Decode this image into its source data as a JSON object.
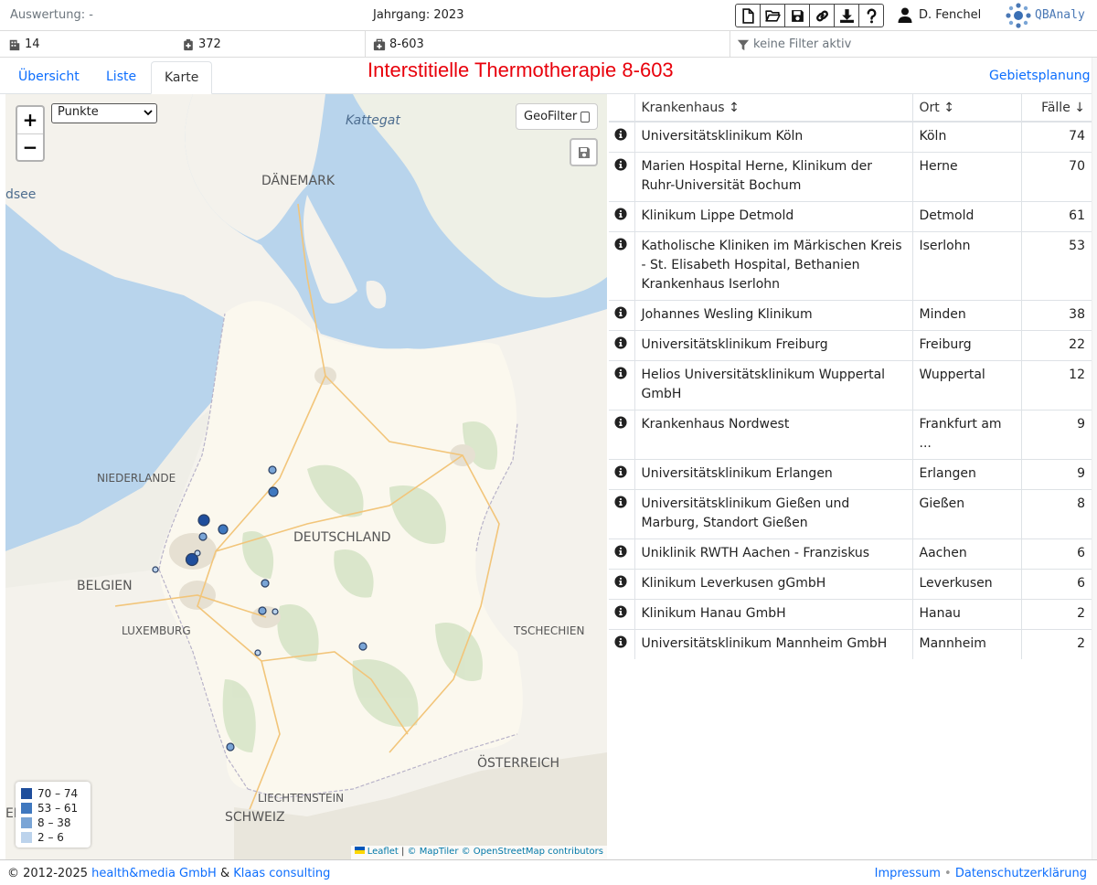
{
  "header": {
    "evaluation_label": "Auswertung:",
    "evaluation_value": "-",
    "year_label": "Jahrgang:",
    "year_value": "2023",
    "user_name": "D. Fenchel",
    "logo_text": "QBAnaly",
    "toolbar_icons": [
      "new-file-icon",
      "open-folder-icon",
      "save-icon",
      "link-icon",
      "download-icon",
      "help-icon"
    ]
  },
  "stats": {
    "hospitals": "14",
    "cases": "372",
    "procedure": "8-603",
    "filter_text": "keine Filter aktiv"
  },
  "tabs": [
    {
      "label": "Übersicht",
      "active": false
    },
    {
      "label": "Liste",
      "active": false
    },
    {
      "label": "Karte",
      "active": true
    }
  ],
  "page_title": "Interstitielle Thermotherapie 8-603",
  "region_link": "Gebietsplanung",
  "map": {
    "layer_select_value": "Punkte",
    "geofilter_label": "GeoFilter",
    "geofilter_checked": false,
    "zoom_in": "+",
    "zoom_out": "−",
    "labels": {
      "kattegat": "Kattegat",
      "daenemark": "DÄNEMARK",
      "dsee": "dsee",
      "niederlande": "NIEDERLANDE",
      "deutschland": "DEUTSCHLAND",
      "belgien": "BELGIEN",
      "luxemburg": "LUXEMBURG",
      "tschechien": "TSCHECHIEN",
      "oesterreich": "ÖSTERREICH",
      "liechtenstein": "LIECHTENSTEIN",
      "schweiz": "SCHWEIZ",
      "ei": "EI"
    },
    "legend": [
      {
        "label": "70 – 74",
        "color": "#1f4e9c"
      },
      {
        "label": "53 – 61",
        "color": "#3f78bf"
      },
      {
        "label": "8 – 38",
        "color": "#7aa5d6"
      },
      {
        "label": "2 – 6",
        "color": "#bcd3ec"
      }
    ],
    "attribution": {
      "leaflet": "Leaflet",
      "sep1": " | ",
      "maptiler": "© MapTiler",
      "sep2": " ",
      "osm": "© OpenStreetMap contributors"
    }
  },
  "table": {
    "headers": {
      "hospital": "Krankenhaus",
      "city": "Ort",
      "cases": "Fälle"
    },
    "rows": [
      {
        "name": "Universitätsklinikum Köln",
        "city": "Köln",
        "cases": "74"
      },
      {
        "name": "Marien Hospital Herne, Klinikum der Ruhr-Universität Bochum",
        "city": "Herne",
        "cases": "70"
      },
      {
        "name": "Klinikum Lippe Detmold",
        "city": "Detmold",
        "cases": "61"
      },
      {
        "name": "Katholische Kliniken im Märkischen Kreis - St. Elisabeth Hospital, Bethanien Krankenhaus Iserlohn",
        "city": "Iserlohn",
        "cases": "53"
      },
      {
        "name": "Johannes Wesling Klinikum",
        "city": "Minden",
        "cases": "38"
      },
      {
        "name": "Universitätsklinikum Freiburg",
        "city": "Freiburg",
        "cases": "22"
      },
      {
        "name": "Helios Universitätsklinikum Wuppertal GmbH",
        "city": "Wuppertal",
        "cases": "12"
      },
      {
        "name": "Krankenhaus Nordwest",
        "city": "Frankfurt am ...",
        "cases": "9"
      },
      {
        "name": "Universitätsklinikum Erlangen",
        "city": "Erlangen",
        "cases": "9"
      },
      {
        "name": "Universitätsklinikum Gießen und Marburg, Standort Gießen",
        "city": "Gießen",
        "cases": "8"
      },
      {
        "name": "Uniklinik RWTH Aachen - Franziskus",
        "city": "Aachen",
        "cases": "6"
      },
      {
        "name": "Klinikum Leverkusen gGmbH",
        "city": "Leverkusen",
        "cases": "6"
      },
      {
        "name": "Klinikum Hanau GmbH",
        "city": "Hanau",
        "cases": "2"
      },
      {
        "name": "Universitätsklinikum Mannheim GmbH",
        "city": "Mannheim",
        "cases": "2"
      }
    ]
  },
  "footer": {
    "copyright": "© 2012-2025",
    "company1": "health&media GmbH",
    "amp": "&",
    "company2": "Klaas consulting",
    "impressum": "Impressum",
    "dot": "•",
    "privacy": "Datenschutzerklärung"
  }
}
